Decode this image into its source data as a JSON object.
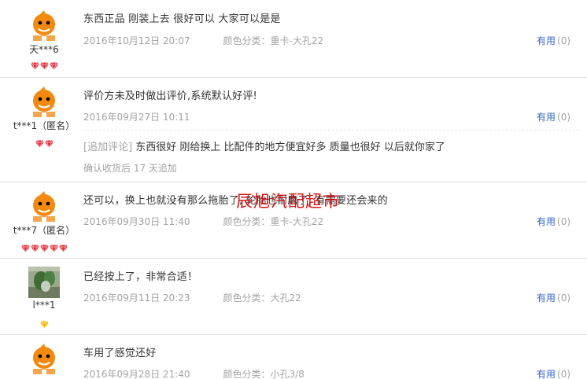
{
  "reviews": [
    {
      "username": "天***6",
      "rating_gems": 3,
      "gem_color": "#e0303a",
      "avatar": "orange-mascot",
      "content": "东西正品 刚装上去 很好可以 大家可以是是",
      "date": "2016年10月12日 20:07",
      "sku": "颜色分类：重卡-大孔22",
      "useful_label": "有用",
      "useful_count": "(0)"
    },
    {
      "username": "t***1（匿名）",
      "rating_gems": 2,
      "gem_color": "#e0303a",
      "avatar": "orange-mascot",
      "content": "评价方未及时做出评价,系统默认好评!",
      "date": "2016年09月27日 10:11",
      "sku": "",
      "useful_label": "有用",
      "useful_count": "(0)",
      "append_tag": "[追加评论]",
      "append_text": " 东西很好 刚给换上 比配件的地方便宜好多 质量也很好 以后就你家了",
      "append_meta": "确认收货后 17 天追加"
    },
    {
      "username": "t***7（匿名）",
      "rating_gems": 5,
      "gem_color": "#e0303a",
      "avatar": "orange-mascot",
      "content": "还可以，换上也就没有那么拖胎了, 轮胎也耐磨了, 有需要还会来的",
      "date": "2016年09月30日 11:40",
      "sku": "颜色分类：重卡-大孔22",
      "useful_label": "有用",
      "useful_count": "(0)"
    },
    {
      "username": "l***1",
      "rating_gems": 1,
      "gem_color": "#f5b400",
      "avatar": "plant-photo",
      "content": "已经按上了，非常合适！",
      "date": "2016年09月11日 20:23",
      "sku": "颜色分类：大孔22",
      "useful_label": "有用",
      "useful_count": "(0)"
    },
    {
      "username": "",
      "rating_gems": 0,
      "gem_color": "#e0303a",
      "avatar": "orange-mascot",
      "content": "车用了感觉还好",
      "date": "2016年09月28日 21:40",
      "sku": "颜色分类：小孔3/8",
      "useful_label": "有用",
      "useful_count": "(0)"
    }
  ],
  "watermark": "辰旭汽配超市"
}
